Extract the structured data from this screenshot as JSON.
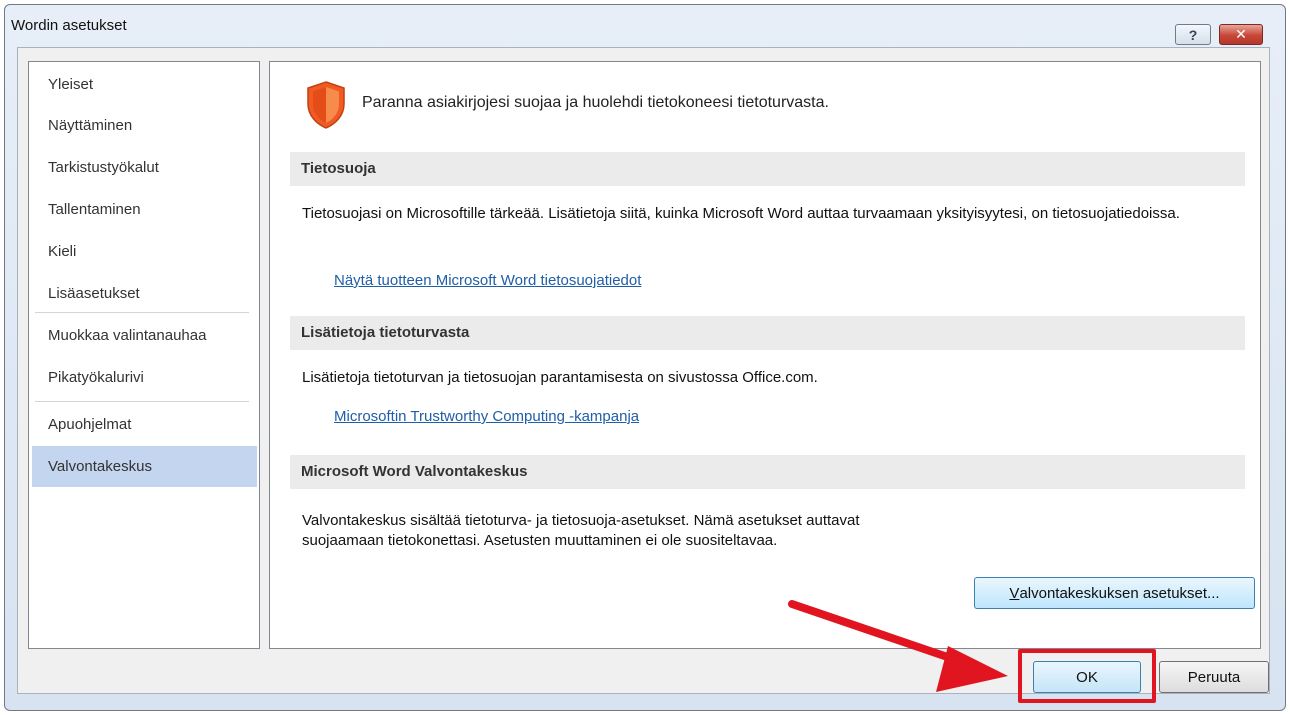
{
  "window": {
    "title": "Wordin asetukset",
    "help_glyph": "?",
    "close_glyph": "✕"
  },
  "nav": {
    "items": [
      {
        "label": "Yleiset"
      },
      {
        "label": "Näyttäminen"
      },
      {
        "label": "Tarkistustyökalut"
      },
      {
        "label": "Tallentaminen"
      },
      {
        "label": "Kieli"
      },
      {
        "label": "Lisäasetukset"
      },
      {
        "label": "Muokkaa valintanauhaa"
      },
      {
        "label": "Pikatyökalurivi"
      },
      {
        "label": "Apuohjelmat"
      },
      {
        "label": "Valvontakeskus",
        "selected": true
      }
    ]
  },
  "content": {
    "headline": "Paranna asiakirjojesi suojaa ja huolehdi tietokoneesi tietoturvasta.",
    "privacy": {
      "header": "Tietosuoja",
      "text": "Tietosuojasi on Microsoftille tärkeää. Lisätietoja siitä, kuinka Microsoft Word auttaa turvaamaan yksityisyytesi, on tietosuojatiedoissa.",
      "link": "Näytä tuotteen Microsoft Word tietosuojatiedot"
    },
    "security": {
      "header": "Lisätietoja tietoturvasta",
      "text": "Lisätietoja tietoturvan ja tietosuojan parantamisesta on sivustossa Office.com.",
      "link": "Microsoftin Trustworthy Computing -kampanja"
    },
    "trust_center": {
      "header": "Microsoft Word Valvontakeskus",
      "text": "Valvontakeskus sisältää tietoturva- ja tietosuoja-asetukset. Nämä asetukset auttavat suojaamaan tietokonettasi. Asetusten muuttaminen ei ole suositeltavaa.",
      "button_accel": "V",
      "button_rest": "alvontakeskuksen asetukset..."
    }
  },
  "footer": {
    "ok_label": "OK",
    "cancel_label": "Peruuta"
  },
  "colors": {
    "accent_red": "#e0151f",
    "selected_nav": "#c3d5ef",
    "link": "#1f5ea8",
    "shield": "#f15a24"
  },
  "annotations": {
    "arrow_target": "ok-button"
  }
}
